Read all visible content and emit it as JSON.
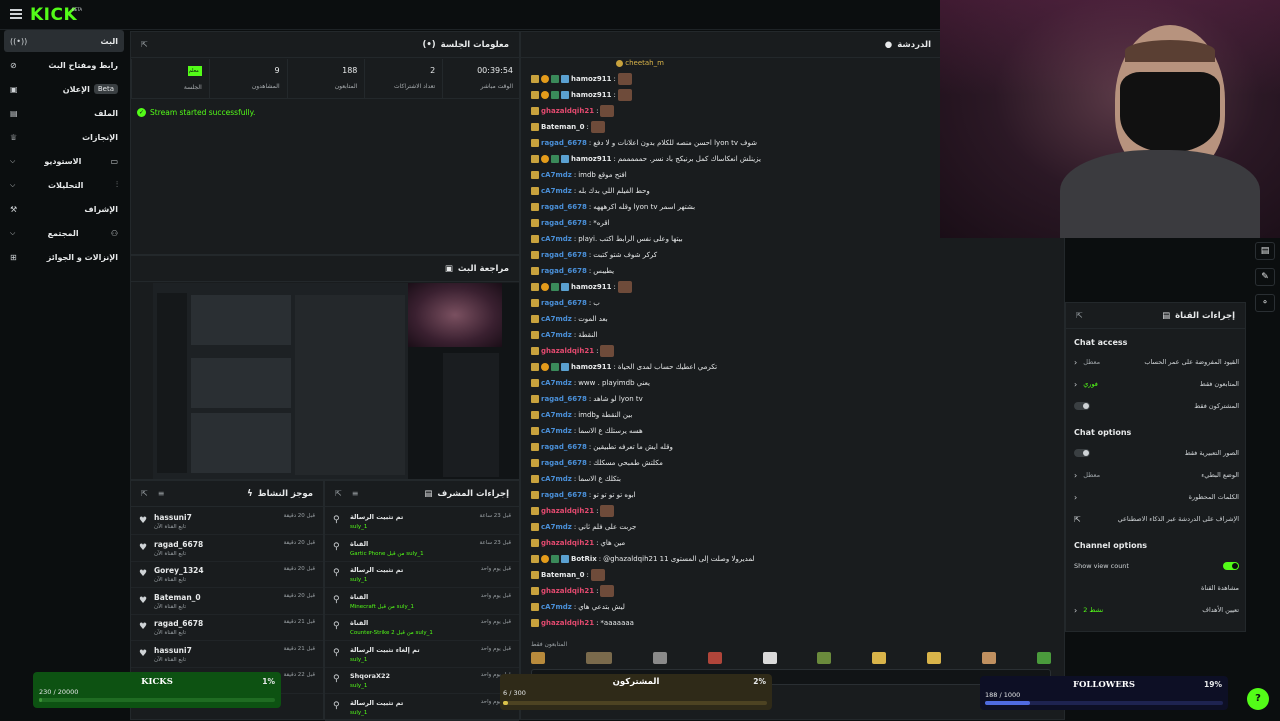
{
  "app": {
    "logo": "KICK",
    "logo_sup": "BETA"
  },
  "sidebar": {
    "items": [
      {
        "label": "البث",
        "icon": "broadcast-icon"
      },
      {
        "label": "رابط ومفتاح البث",
        "icon": "link-icon"
      },
      {
        "label": "الإعلان",
        "icon": "ad-icon",
        "badge": "Beta"
      },
      {
        "label": "الملف",
        "icon": "profile-icon"
      },
      {
        "label": "الإنجازات",
        "icon": "trophy-icon"
      },
      {
        "label": "الاستوديو",
        "icon": "studio-icon"
      },
      {
        "label": "التحليلات",
        "icon": "chart-icon"
      },
      {
        "label": "الإشراف",
        "icon": "hammer-icon"
      },
      {
        "label": "المجتمع",
        "icon": "people-icon"
      },
      {
        "label": "الإنزالات و الجوائز",
        "icon": "gift-icon"
      }
    ]
  },
  "session": {
    "title": "معلومات الجلسة",
    "stats": [
      {
        "value": "00:39:54",
        "label": "الوقت مباشر"
      },
      {
        "value": "2",
        "label": "تعداد الاشتراكات"
      },
      {
        "value": "188",
        "label": "المتابعون"
      },
      {
        "value": "9",
        "label": "المشاهدون"
      },
      {
        "value": "معلم",
        "label": "الجلسة"
      }
    ],
    "message": "Stream started successfully."
  },
  "preview": {
    "title": "مراجعة البث"
  },
  "activity": {
    "title": "موجز النشاط",
    "items": [
      {
        "user": "hassuni7",
        "desc": "تابع القناة الآن",
        "time": "قبل 20 دقيقة"
      },
      {
        "user": "ragad_6678",
        "desc": "تابع القناة الآن",
        "time": "قبل 20 دقيقة"
      },
      {
        "user": "Gorey_1324",
        "desc": "تابع القناة الآن",
        "time": "قبل 20 دقيقة"
      },
      {
        "user": "Bateman_0",
        "desc": "تابع القناة الآن",
        "time": "قبل 20 دقيقة"
      },
      {
        "user": "ragad_6678",
        "desc": "تابع القناة الآن",
        "time": "قبل 21 دقيقة"
      },
      {
        "user": "hassuni7",
        "desc": "تابع القناة الآن",
        "time": "قبل 21 دقيقة"
      },
      {
        "user": "",
        "desc": "",
        "time": "قبل 22 دقيقة"
      }
    ]
  },
  "modlog": {
    "title": "إجراءات المشرف",
    "items": [
      {
        "title": "تم تثبيت الرسالة",
        "by": "suly_1",
        "time": "قبل 23 ساعة"
      },
      {
        "title": "القناة",
        "by": "Gartic Phone من قبل suly_1",
        "time": "قبل 23 ساعة"
      },
      {
        "title": "تم تثبيت الرسالة",
        "by": "suly_1",
        "time": "قبل يوم واحد"
      },
      {
        "title": "القناة",
        "by": "Minecraft من قبل suly_1",
        "time": "قبل يوم واحد"
      },
      {
        "title": "القناة",
        "by": "Counter-Strike 2 من قبل suly_1",
        "time": "قبل يوم واحد"
      },
      {
        "title": "تم إلغاء تثبيت الرسالة",
        "by": "suly_1",
        "time": "قبل يوم واحد"
      },
      {
        "title": "ShqoraX22",
        "by": "suly_1",
        "time": "قبل يوم واحد"
      },
      {
        "title": "تم تثبيت الرسالة",
        "by": "suly_1",
        "time": "قبل يوم واحد"
      }
    ]
  },
  "chat": {
    "title": "الدردشة",
    "pinned_user": "cheetah_m",
    "messages": [
      {
        "user": "hamoz911",
        "color": "#e7e9ea",
        "text": ""
      },
      {
        "user": "hamoz911",
        "color": "#e7e9ea",
        "text": ""
      },
      {
        "user": "ghazaldqih21",
        "color": "#e34a6f",
        "text": ""
      },
      {
        "user": "Bateman_0",
        "color": "#e7e9ea",
        "text": ""
      },
      {
        "user": "ragad_6678",
        "color": "#4a90d9",
        "text": "احسن منصه للكلام بدون اعلانات و لا دفع lyon tv شوف"
      },
      {
        "user": "hamoz911",
        "color": "#e7e9ea",
        "text": "يزينلش انعكاساك كمل برنيكج باد نسر. حمممممم"
      },
      {
        "user": "cA7mdz",
        "color": "#4a90d9",
        "text": "imdb افتح موقع"
      },
      {
        "user": "cA7mdz",
        "color": "#4a90d9",
        "text": "وحط الفيلم اللي بدك بله"
      },
      {
        "user": "ragad_6678",
        "color": "#4a90d9",
        "text": "وقله اكرهههه lyon tv بشتهر اسمر"
      },
      {
        "user": "ragad_6678",
        "color": "#4a90d9",
        "text": "*اقره"
      },
      {
        "user": "cA7mdz",
        "color": "#4a90d9",
        "text": "playi. بيتها وعلى نفس الرابط اكتب"
      },
      {
        "user": "ragad_6678",
        "color": "#4a90d9",
        "text": "كركر شوف شتو كتبت"
      },
      {
        "user": "ragad_6678",
        "color": "#4a90d9",
        "text": "يطيبس"
      },
      {
        "user": "hamoz911",
        "color": "#e7e9ea",
        "text": ""
      },
      {
        "user": "ragad_6678",
        "color": "#4a90d9",
        "text": "ب"
      },
      {
        "user": "cA7mdz",
        "color": "#4a90d9",
        "text": "بعد الموت"
      },
      {
        "user": "cA7mdz",
        "color": "#4a90d9",
        "text": "النقطة"
      },
      {
        "user": "ghazaldqih21",
        "color": "#e34a6f",
        "text": ""
      },
      {
        "user": "hamoz911",
        "color": "#e7e9ea",
        "text": "تكرمي اعطيك حساب لمدى الحياة"
      },
      {
        "user": "cA7mdz",
        "color": "#4a90d9",
        "text": "www . playimdb يعني"
      },
      {
        "user": "ragad_6678",
        "color": "#4a90d9",
        "text": "لو شاهد lyon tv"
      },
      {
        "user": "cA7mdz",
        "color": "#4a90d9",
        "text": "imdbبين النقطة و"
      },
      {
        "user": "cA7mdz",
        "color": "#4a90d9",
        "text": "هسه يرستلك ع الاسما"
      },
      {
        "user": "ragad_6678",
        "color": "#4a90d9",
        "text": "وقله ايش ما تعرفه تطبيقين"
      },
      {
        "user": "ragad_6678",
        "color": "#4a90d9",
        "text": "مكلتش طمبحي مسكلك"
      },
      {
        "user": "cA7mdz",
        "color": "#4a90d9",
        "text": "بتكلك ع الاسما"
      },
      {
        "user": "ragad_6678",
        "color": "#4a90d9",
        "text": "ابوه تو تو تو تو"
      },
      {
        "user": "ghazaldqih21",
        "color": "#e34a6f",
        "text": ""
      },
      {
        "user": "cA7mdz",
        "color": "#4a90d9",
        "text": "جربت على فلم ثاني"
      },
      {
        "user": "ghazaldqih21",
        "color": "#e34a6f",
        "text": "مين هاي"
      },
      {
        "user": "BotRix",
        "color": "#e7e9ea",
        "text": "@ghazaldqih21 لمديرولا وصلت إلى المستوى 11"
      },
      {
        "user": "Bateman_0",
        "color": "#e7e9ea",
        "text": ""
      },
      {
        "user": "ghazaldqih21",
        "color": "#e34a6f",
        "text": ""
      },
      {
        "user": "cA7mdz",
        "color": "#4a90d9",
        "text": "ليش بتدعي هاي"
      },
      {
        "user": "ghazaldqih21",
        "color": "#e34a6f",
        "text": "*aaaaaaa"
      }
    ],
    "footer": "المتابعون فقط"
  },
  "channel_actions": {
    "title": "إجراءات القناة",
    "chat_access_heading": "Chat access",
    "rows_access": [
      {
        "label": "القيود المفروضة على عمر الحساب",
        "value": "معطل",
        "control": "chevron"
      },
      {
        "label": "المتابعون فقط",
        "value": "فوري",
        "control": "chevron"
      },
      {
        "label": "المشتركون فقط",
        "value": "",
        "control": "toggle-off"
      }
    ],
    "chat_options_heading": "Chat options",
    "rows_options": [
      {
        "label": "الصور التعبيرية فقط",
        "value": "",
        "control": "toggle-off"
      },
      {
        "label": "الوضع البطيء",
        "value": "معطل",
        "control": "chevron"
      },
      {
        "label": "الكلمات المحظورة",
        "value": "",
        "control": "chevron"
      },
      {
        "label": "الإشراف على الدردشة عبر الذكاء الاصطناعي",
        "value": "",
        "control": "external"
      }
    ],
    "channel_options_heading": "Channel options",
    "rows_channel": [
      {
        "label": "Show view count",
        "value": "",
        "control": "toggle-on"
      },
      {
        "label": "مشاهدة القناة",
        "value": "",
        "control": "none"
      },
      {
        "label": "تعيين الأهداف",
        "value": "نشط 2",
        "control": "chevron"
      }
    ]
  },
  "goals": {
    "kicks": {
      "label": "KICKS",
      "percent": "1%",
      "progress": "230 / 20000",
      "fraction": 0.0115
    },
    "subs": {
      "label": "المشتركون",
      "percent": "2%",
      "progress": "6 / 300",
      "fraction": 0.02
    },
    "followers": {
      "label": "FOLLOWERS",
      "percent": "19%",
      "progress": "188 / 1000",
      "fraction": 0.188
    }
  },
  "colors": {
    "accent": "#53fc18",
    "panel": "#191c1e",
    "bg": "#0b0e0f"
  }
}
